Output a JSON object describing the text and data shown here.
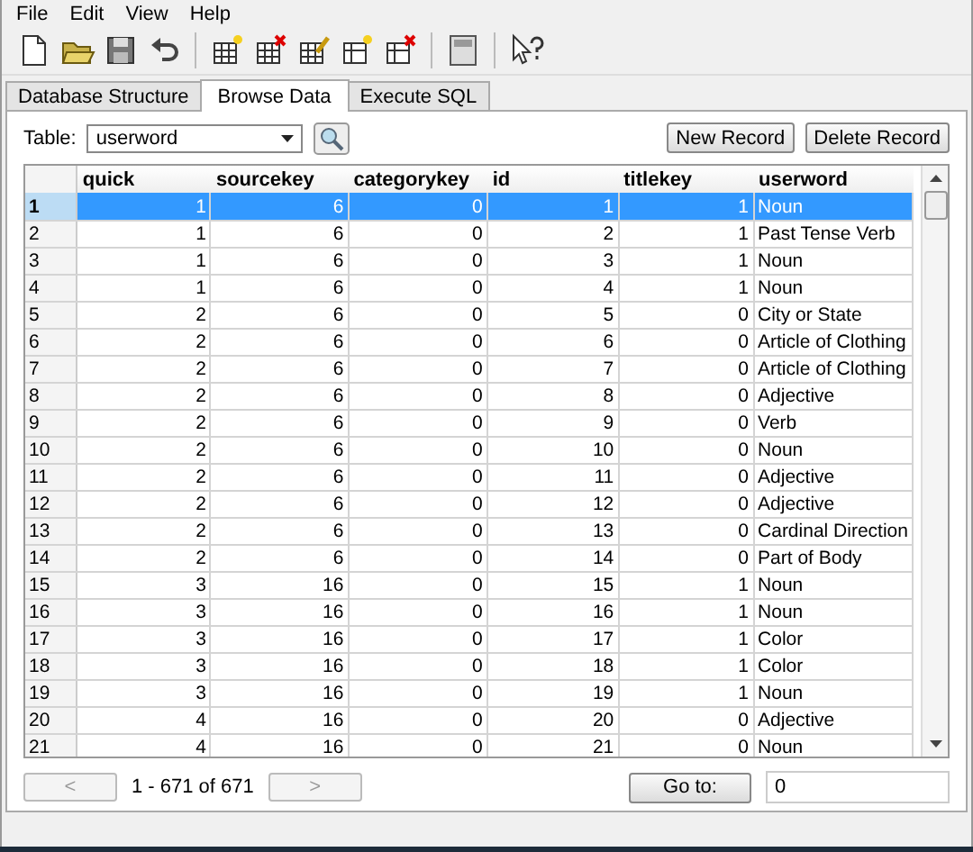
{
  "menu": [
    "File",
    "Edit",
    "View",
    "Help"
  ],
  "tabs": [
    {
      "label": "Database Structure",
      "selected": false
    },
    {
      "label": "Browse Data",
      "selected": true
    },
    {
      "label": "Execute SQL",
      "selected": false
    }
  ],
  "table_picker": {
    "label": "Table:",
    "value": "userword"
  },
  "buttons": [
    "New Record",
    "Delete Record"
  ],
  "table": {
    "columns": [
      "quick",
      "sourcekey",
      "categorykey",
      "id",
      "titlekey",
      "userword"
    ],
    "rows": [
      {
        "header": "1",
        "cells": [
          "1",
          "6",
          "0",
          "1",
          "1",
          "Noun"
        ],
        "selected": true
      },
      {
        "header": "2",
        "cells": [
          "1",
          "6",
          "0",
          "2",
          "1",
          "Past Tense Verb"
        ],
        "selected": false
      },
      {
        "header": "3",
        "cells": [
          "1",
          "6",
          "0",
          "3",
          "1",
          "Noun"
        ],
        "selected": false
      },
      {
        "header": "4",
        "cells": [
          "1",
          "6",
          "0",
          "4",
          "1",
          "Noun"
        ],
        "selected": false
      },
      {
        "header": "5",
        "cells": [
          "2",
          "6",
          "0",
          "5",
          "0",
          "City or State"
        ],
        "selected": false
      },
      {
        "header": "6",
        "cells": [
          "2",
          "6",
          "0",
          "6",
          "0",
          "Article of Clothing"
        ],
        "selected": false
      },
      {
        "header": "7",
        "cells": [
          "2",
          "6",
          "0",
          "7",
          "0",
          "Article of Clothing"
        ],
        "selected": false
      },
      {
        "header": "8",
        "cells": [
          "2",
          "6",
          "0",
          "8",
          "0",
          "Adjective"
        ],
        "selected": false
      },
      {
        "header": "9",
        "cells": [
          "2",
          "6",
          "0",
          "9",
          "0",
          "Verb"
        ],
        "selected": false
      },
      {
        "header": "10",
        "cells": [
          "2",
          "6",
          "0",
          "10",
          "0",
          "Noun"
        ],
        "selected": false
      },
      {
        "header": "11",
        "cells": [
          "2",
          "6",
          "0",
          "11",
          "0",
          "Adjective"
        ],
        "selected": false
      },
      {
        "header": "12",
        "cells": [
          "2",
          "6",
          "0",
          "12",
          "0",
          "Adjective"
        ],
        "selected": false
      },
      {
        "header": "13",
        "cells": [
          "2",
          "6",
          "0",
          "13",
          "0",
          "Cardinal Direction"
        ],
        "selected": false
      },
      {
        "header": "14",
        "cells": [
          "2",
          "6",
          "0",
          "14",
          "0",
          "Part of Body"
        ],
        "selected": false
      },
      {
        "header": "15",
        "cells": [
          "3",
          "16",
          "0",
          "15",
          "1",
          "Noun"
        ],
        "selected": false
      },
      {
        "header": "16",
        "cells": [
          "3",
          "16",
          "0",
          "16",
          "1",
          "Noun"
        ],
        "selected": false
      },
      {
        "header": "17",
        "cells": [
          "3",
          "16",
          "0",
          "17",
          "1",
          "Color"
        ],
        "selected": false
      },
      {
        "header": "18",
        "cells": [
          "3",
          "16",
          "0",
          "18",
          "1",
          "Color"
        ],
        "selected": false
      },
      {
        "header": "19",
        "cells": [
          "3",
          "16",
          "0",
          "19",
          "1",
          "Noun"
        ],
        "selected": false
      },
      {
        "header": "20",
        "cells": [
          "4",
          "16",
          "0",
          "20",
          "0",
          "Adjective"
        ],
        "selected": false
      },
      {
        "header": "21",
        "cells": [
          "4",
          "16",
          "0",
          "21",
          "0",
          "Noun"
        ],
        "selected": false
      }
    ]
  },
  "pager": {
    "prev": "<",
    "range": "1 - 671 of 671",
    "next": ">",
    "goto_button": "Go to:",
    "goto_value": "0"
  }
}
